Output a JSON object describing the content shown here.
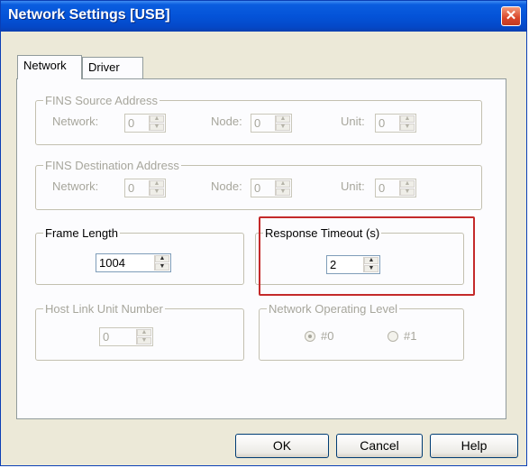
{
  "window": {
    "title": "Network Settings [USB]",
    "close_label": "✕"
  },
  "tabs": [
    {
      "label": "Network",
      "active": true
    },
    {
      "label": "Driver",
      "active": false
    }
  ],
  "fins_source": {
    "legend": "FINS Source Address",
    "network_label": "Network:",
    "network_value": "0",
    "node_label": "Node:",
    "node_value": "0",
    "unit_label": "Unit:",
    "unit_value": "0"
  },
  "fins_destination": {
    "legend": "FINS Destination Address",
    "network_label": "Network:",
    "network_value": "0",
    "node_label": "Node:",
    "node_value": "0",
    "unit_label": "Unit:",
    "unit_value": "0"
  },
  "frame_length": {
    "legend": "Frame Length",
    "value": "1004"
  },
  "response_timeout": {
    "legend": "Response Timeout (s)",
    "value": "2"
  },
  "host_link": {
    "legend": "Host Link Unit Number",
    "value": "0"
  },
  "network_level": {
    "legend": "Network Operating Level",
    "options": [
      {
        "label": "#0",
        "selected": true
      },
      {
        "label": "#1",
        "selected": false
      }
    ]
  },
  "buttons": {
    "ok": "OK",
    "cancel": "Cancel",
    "help": "Help"
  },
  "colors": {
    "titlebar": "#0453d8",
    "dialog_bg": "#ece9d8",
    "highlight_box": "#c42a2a",
    "disabled_text": "#a7a69c"
  },
  "icons": {
    "spin_up": "▲",
    "spin_down": "▼"
  }
}
